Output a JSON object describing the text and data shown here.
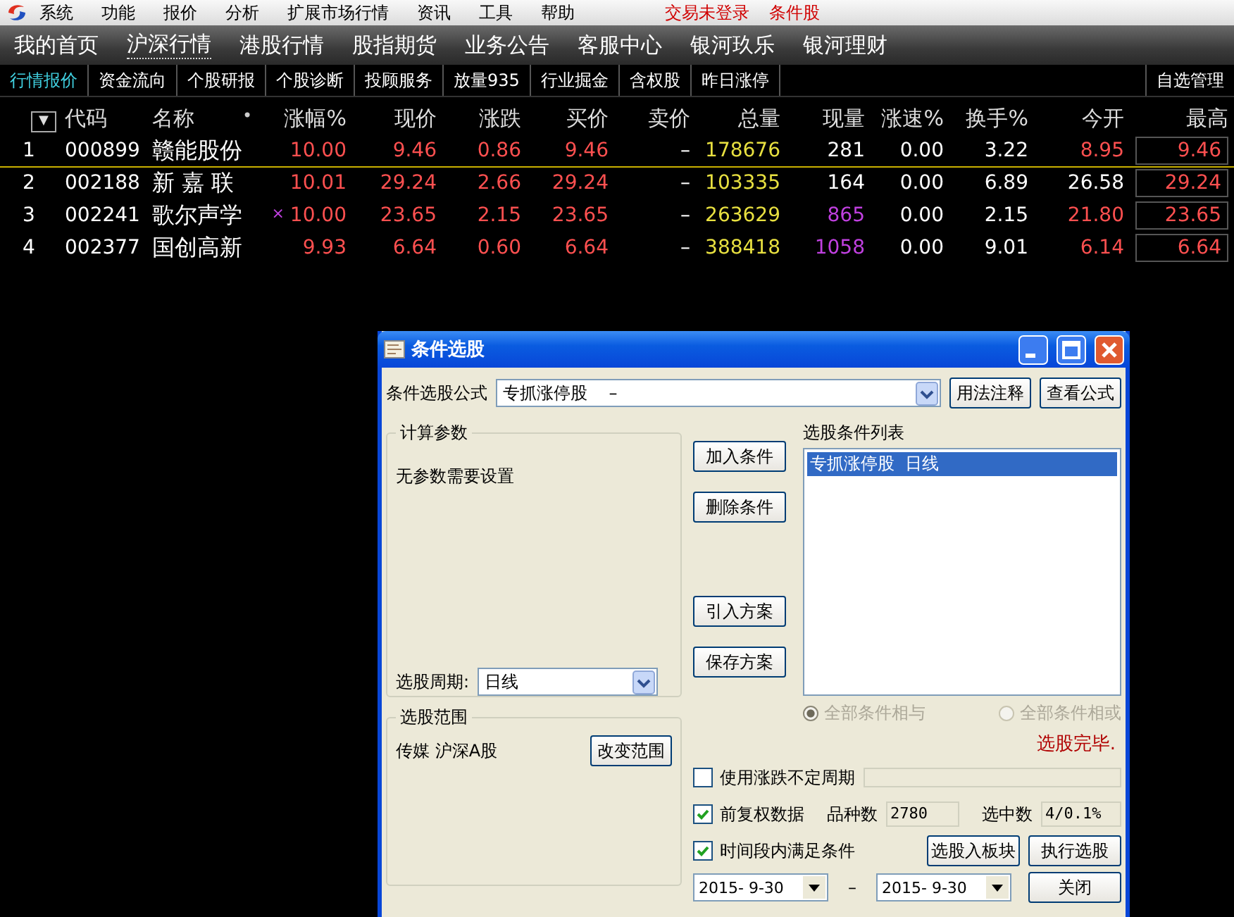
{
  "menu_bar": {
    "items": [
      "系统",
      "功能",
      "报价",
      "分析",
      "扩展市场行情",
      "资讯",
      "工具",
      "帮助"
    ],
    "status": [
      "交易未登录",
      "条件股"
    ]
  },
  "nav_bar": {
    "items": [
      {
        "label": "我的首页",
        "selected": false
      },
      {
        "label": "沪深行情",
        "selected": true
      },
      {
        "label": "港股行情",
        "selected": false
      },
      {
        "label": "股指期货",
        "selected": false
      },
      {
        "label": "业务公告",
        "selected": false
      },
      {
        "label": "客服中心",
        "selected": false
      },
      {
        "label": "银河玖乐",
        "selected": false
      },
      {
        "label": "银河理财",
        "selected": false
      }
    ]
  },
  "function_tabs": {
    "items": [
      {
        "label": "行情报价",
        "selected": true
      },
      {
        "label": "资金流向",
        "selected": false
      },
      {
        "label": "个股研报",
        "selected": false
      },
      {
        "label": "个股诊断",
        "selected": false
      },
      {
        "label": "投顾服务",
        "selected": false
      },
      {
        "label": "放量935",
        "selected": false
      },
      {
        "label": "行业掘金",
        "selected": false
      },
      {
        "label": "含权股",
        "selected": false
      },
      {
        "label": "昨日涨停",
        "selected": false
      }
    ],
    "right_link": "自选管理"
  },
  "quote_table": {
    "menu_glyph": "▼",
    "sort_mark": "•",
    "columns": [
      "代码",
      "名称",
      "涨幅%",
      "现价",
      "涨跌",
      "买价",
      "卖价",
      "总量",
      "现量",
      "涨速%",
      "换手%",
      "今开",
      "最高"
    ],
    "rows": [
      {
        "index": "1",
        "selected": true,
        "cells": [
          {
            "text": "000899",
            "kind": "plain"
          },
          {
            "text": "赣能股份",
            "kind": "name"
          },
          {
            "text": "10.00",
            "kind": "up"
          },
          {
            "text": "9.46",
            "kind": "up"
          },
          {
            "text": "0.86",
            "kind": "up"
          },
          {
            "text": "9.46",
            "kind": "up"
          },
          {
            "text": "–",
            "kind": "plain"
          },
          {
            "text": "178676",
            "kind": "volume"
          },
          {
            "text": "281",
            "kind": "plain"
          },
          {
            "text": "0.00",
            "kind": "plain"
          },
          {
            "text": "3.22",
            "kind": "plain"
          },
          {
            "text": "8.95",
            "kind": "up"
          },
          {
            "text": "9.46",
            "kind": "boxed"
          }
        ]
      },
      {
        "index": "2",
        "selected": false,
        "cells": [
          {
            "text": "002188",
            "kind": "plain"
          },
          {
            "text": "新 嘉 联",
            "kind": "name"
          },
          {
            "text": "10.01",
            "kind": "up"
          },
          {
            "text": "29.24",
            "kind": "up"
          },
          {
            "text": "2.66",
            "kind": "up"
          },
          {
            "text": "29.24",
            "kind": "up"
          },
          {
            "text": "–",
            "kind": "plain"
          },
          {
            "text": "103335",
            "kind": "volume"
          },
          {
            "text": "164",
            "kind": "plain"
          },
          {
            "text": "0.00",
            "kind": "plain"
          },
          {
            "text": "6.89",
            "kind": "plain"
          },
          {
            "text": "26.58",
            "kind": "plain"
          },
          {
            "text": "29.24",
            "kind": "boxed"
          }
        ]
      },
      {
        "index": "3",
        "selected": false,
        "cells": [
          {
            "text": "002241",
            "kind": "plain"
          },
          {
            "text": "歌尔声学",
            "kind": "name"
          },
          {
            "text": "10.00",
            "kind": "up",
            "flag": "×"
          },
          {
            "text": "23.65",
            "kind": "up"
          },
          {
            "text": "2.15",
            "kind": "up"
          },
          {
            "text": "23.65",
            "kind": "up"
          },
          {
            "text": "–",
            "kind": "plain"
          },
          {
            "text": "263629",
            "kind": "volume"
          },
          {
            "text": "865",
            "kind": "big"
          },
          {
            "text": "0.00",
            "kind": "plain"
          },
          {
            "text": "2.15",
            "kind": "plain"
          },
          {
            "text": "21.80",
            "kind": "up"
          },
          {
            "text": "23.65",
            "kind": "boxed"
          }
        ]
      },
      {
        "index": "4",
        "selected": false,
        "cells": [
          {
            "text": "002377",
            "kind": "plain"
          },
          {
            "text": "国创高新",
            "kind": "name"
          },
          {
            "text": "9.93",
            "kind": "up"
          },
          {
            "text": "6.64",
            "kind": "up"
          },
          {
            "text": "0.60",
            "kind": "up"
          },
          {
            "text": "6.64",
            "kind": "up"
          },
          {
            "text": "–",
            "kind": "plain"
          },
          {
            "text": "388418",
            "kind": "volume"
          },
          {
            "text": "1058",
            "kind": "big"
          },
          {
            "text": "0.00",
            "kind": "plain"
          },
          {
            "text": "9.01",
            "kind": "plain"
          },
          {
            "text": "6.14",
            "kind": "up"
          },
          {
            "text": "6.64",
            "kind": "boxed"
          }
        ]
      }
    ]
  },
  "dialog": {
    "title": "条件选股",
    "formula_label": "条件选股公式",
    "formula_value": "专抓涨停股    –",
    "formula_buttons": [
      "用法注释",
      "查看公式"
    ],
    "params_group": {
      "title": "计算参数",
      "message": "无参数需要设置",
      "period_label": "选股周期:",
      "period_value": "日线"
    },
    "condition_buttons": [
      "加入条件",
      "删除条件",
      "引入方案",
      "保存方案"
    ],
    "condition_list": {
      "title": "选股条件列表",
      "items": [
        {
          "text": "专抓涨停股  日线",
          "selected": true
        }
      ]
    },
    "logic_options": [
      {
        "label": "全部条件相与",
        "selected": true,
        "disabled": true
      },
      {
        "label": "全部条件相或",
        "selected": false,
        "disabled": true
      }
    ],
    "range_group": {
      "title": "选股范围",
      "value": "传媒  沪深A股",
      "button": "改变范围"
    },
    "status": "选股完毕.",
    "options": [
      {
        "label": "使用涨跌不定周期",
        "checked": false
      },
      {
        "label": "前复权数据",
        "checked": true
      },
      {
        "label": "时间段内满足条件",
        "checked": true
      }
    ],
    "counts": [
      {
        "label": "品种数",
        "value": "2780"
      },
      {
        "label": "选中数",
        "value": "4/0.1%"
      }
    ],
    "actions": [
      "选股入板块",
      "执行选股",
      "关闭"
    ],
    "date_range": {
      "start": "2015- 9-30",
      "separator": "–",
      "end": "2015- 9-30"
    }
  }
}
